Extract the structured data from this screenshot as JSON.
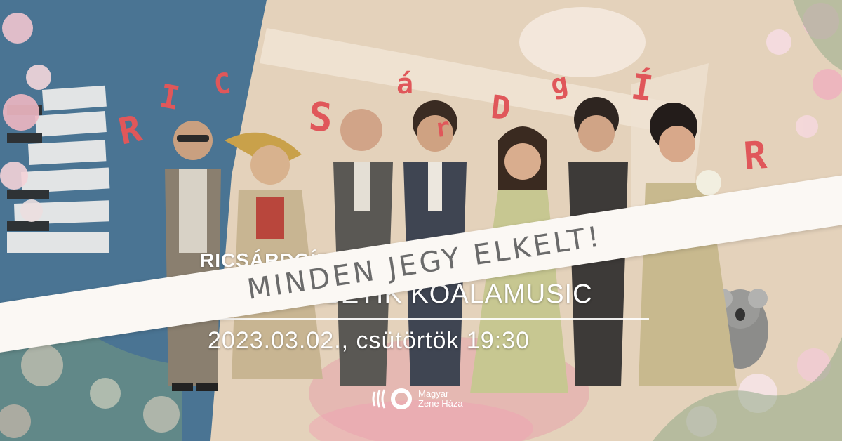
{
  "letters": [
    {
      "char": "R",
      "color": "#e0575a"
    },
    {
      "char": "I",
      "color": "#e0575a"
    },
    {
      "char": "C",
      "color": "#e0575a"
    },
    {
      "char": "S",
      "color": "#e0575a"
    },
    {
      "char": "á",
      "color": "#e0575a"
    },
    {
      "char": "r",
      "color": "#e0575a"
    },
    {
      "char": "D",
      "color": "#e0575a"
    },
    {
      "char": "g",
      "color": "#e0575a"
    },
    {
      "char": "Í",
      "color": "#e0575a"
    },
    {
      "char": "R",
      "color": "#e0575a"
    }
  ],
  "event": {
    "title_partial": "RICSÁRDGÍR",
    "subtitle": "AKUSZTIK KOALAMUSIC",
    "datetime": "2023.03.02., csütörtök 19:30"
  },
  "banner": {
    "text": "MINDEN JEGY ELKELT!"
  },
  "logo": {
    "line1": "Magyar",
    "line2": "Zene Háza",
    "icon": "mzh-logo-icon"
  },
  "colors": {
    "accent_red": "#e0575a",
    "blue_panel": "#4a7493",
    "beige": "#e3d0b8",
    "banner_bg": "#fbf8f4",
    "banner_text": "#6b6b6b"
  }
}
